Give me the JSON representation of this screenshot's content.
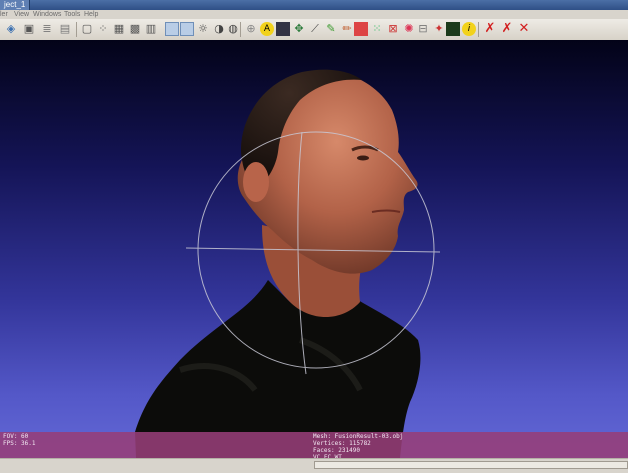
{
  "window": {
    "tab_title": "ject_1"
  },
  "menu": {
    "items": [
      "ler",
      "View",
      "Windows",
      "Tools",
      "Help"
    ]
  },
  "toolbar": {
    "icons": [
      "import-mesh-icon",
      "snapshot-icon",
      "layers-icon",
      "color-icon",
      "bbox-icon",
      "points-icon",
      "wireframe-icon",
      "hidden-lines-icon",
      "flat-shading-icon",
      "smooth-shading-icon",
      "texture-icon",
      "light-icon",
      "colorize-icon",
      "trackball-icon",
      "info-mode-icon",
      "background-color-icon",
      "pick-icon",
      "measure-icon",
      "align-icon",
      "paint-icon",
      "texture-param-icon",
      "select-faces-icon",
      "select-vertices-icon",
      "z-paint-icon",
      "edit-mesh-icon",
      "quality-icon",
      "raster-icon",
      "info-icon",
      "delete-icon",
      "delete-faces-icon",
      "close-icon"
    ]
  },
  "viewport": {
    "fov_label": "FOV: 60",
    "fps_label": "FPS:   36.1",
    "mesh_label": "Mesh: FusionResult-03.obj",
    "vertices_label": "Vertices: 115782",
    "faces_label": "Faces: 231490",
    "attr_label": "VC FC WT"
  },
  "colors": {
    "bg_top": "#030318",
    "bg_bottom": "#6368d6",
    "info_band": "#963e78"
  }
}
